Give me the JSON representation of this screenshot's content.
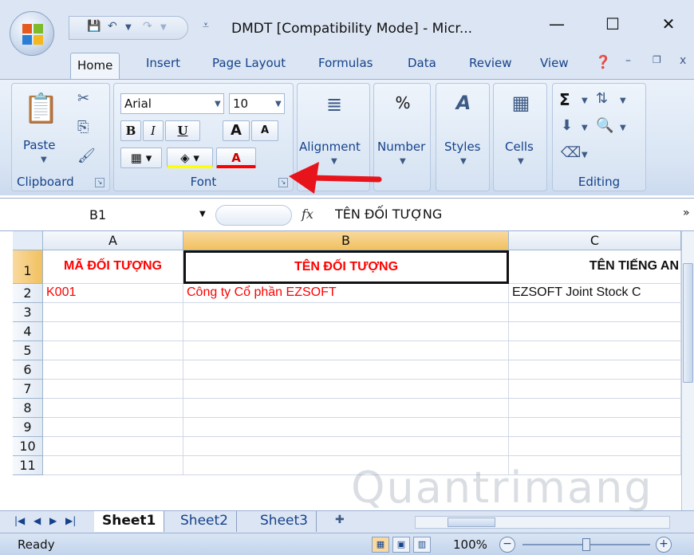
{
  "window": {
    "title": "DMDT  [Compatibility Mode] - Micr...",
    "minimize_glyph": "—",
    "maximize_glyph": "☐",
    "close_glyph": "✕"
  },
  "tabs": [
    "Home",
    "Insert",
    "Page Layout",
    "Formulas",
    "Data",
    "Review",
    "View"
  ],
  "active_tab": "Home",
  "ribbon": {
    "clipboard": {
      "paste_label": "Paste",
      "group_label": "Clipboard"
    },
    "font": {
      "font_name": "Arial",
      "font_size": "10",
      "bold": "B",
      "italic": "I",
      "underline": "U",
      "grow": "A",
      "shrink": "A",
      "font_color": "A",
      "group_label": "Font"
    },
    "alignment_label": "Alignment",
    "number_label": "Number",
    "number_icon": "%",
    "styles_label": "Styles",
    "cells_label": "Cells",
    "editing": {
      "sum_icon": "Σ",
      "group_label": "Editing"
    }
  },
  "formula_bar": {
    "name_box": "B1",
    "fx": "fx",
    "content": "TÊN ĐỐI TƯỢNG"
  },
  "grid": {
    "columns": [
      "A",
      "B",
      "C"
    ],
    "rows": [
      "1",
      "2",
      "3",
      "4",
      "5",
      "6",
      "7",
      "8",
      "9",
      "10",
      "11"
    ],
    "row1": [
      "MÃ ĐỐI TƯỢNG",
      "TÊN ĐỐI TƯỢNG",
      "TÊN TIẾNG AN"
    ],
    "row2": [
      "K001",
      "Công ty Cổ phần EZSOFT",
      "EZSOFT Joint Stock C"
    ]
  },
  "sheets": [
    "Sheet1",
    "Sheet2",
    "Sheet3"
  ],
  "active_sheet": "Sheet1",
  "status": {
    "mode": "Ready",
    "zoom": "100%"
  },
  "watermark": "Quantrimang",
  "colors": {
    "header_text": "#ff0000",
    "row2_a_b_text": "#ff0000",
    "accent_blue": "#15428b",
    "arrow_red": "#e8141b"
  }
}
